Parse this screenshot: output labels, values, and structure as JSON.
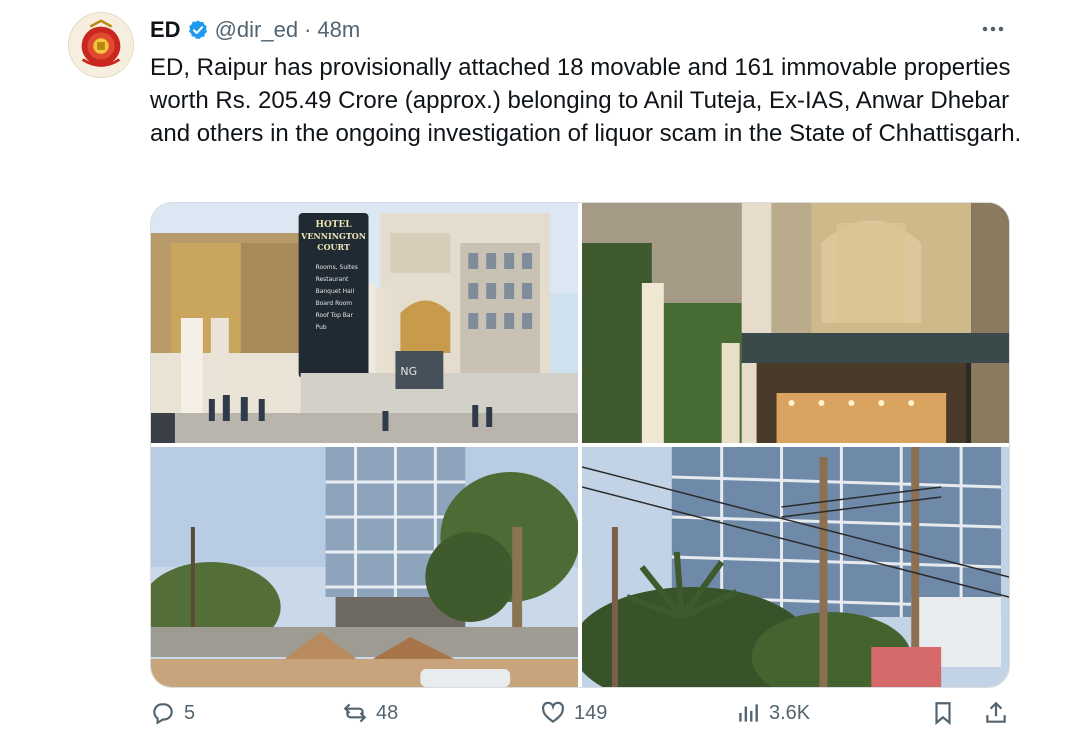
{
  "author": {
    "name": "ED",
    "handle": "@dir_ed",
    "separator": "·",
    "time": "48m",
    "verified": true,
    "avatar_icon": "ed-emblem"
  },
  "tweet": {
    "text": "ED, Raipur has provisionally attached 18 movable and 161 immovable properties worth Rs. 205.49 Crore (approx.) belonging to Anil Tuteja, Ex-IAS, Anwar Dhebar and others in the ongoing investigation of liquor scam in the State of Chhattisgarh."
  },
  "media": {
    "sign_text": {
      "line1": "HOTEL",
      "line2": "VENNINGTON",
      "line3": "COURT",
      "line4": "Rooms, Suites",
      "line5": "Restaurant",
      "line6": "Banquet Hall",
      "line7": "Board Room",
      "line8": "Roof Top Bar",
      "line9": "Pub"
    },
    "wall_text": "NG",
    "photos": [
      {
        "icon": "hotel-facade-photo"
      },
      {
        "icon": "hotel-entrance-night-photo"
      },
      {
        "icon": "glass-building-construction-photo"
      },
      {
        "icon": "glass-building-trees-photo"
      }
    ]
  },
  "actions": {
    "replies": "5",
    "reposts": "48",
    "likes": "149",
    "views": "3.6K",
    "icons": [
      "reply-icon",
      "repost-icon",
      "like-icon",
      "views-icon",
      "bookmark-icon",
      "share-icon"
    ]
  },
  "colors": {
    "verified_blue": "#1d9bf0",
    "secondary_text": "#536471",
    "primary_text": "#0f1419"
  }
}
